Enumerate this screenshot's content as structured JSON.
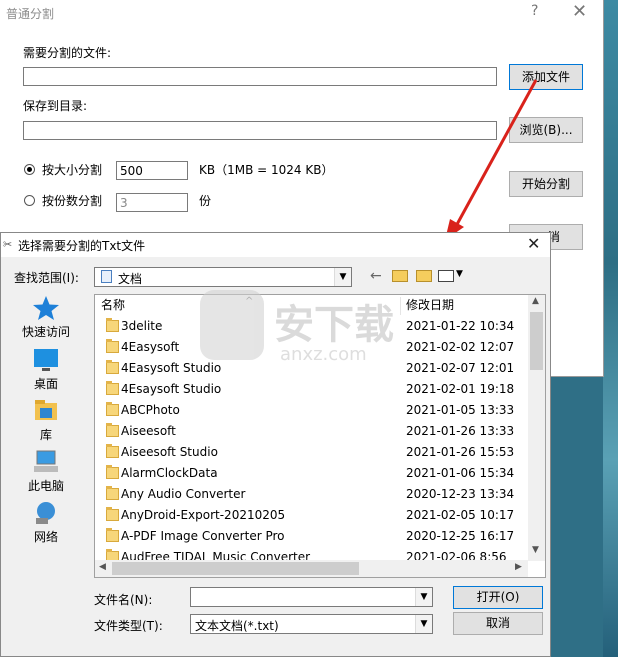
{
  "main_window": {
    "title": "普通分割",
    "help_glyph": "?",
    "close_glyph": "✕",
    "source_label": "需要分割的文件:",
    "source_value": "",
    "add_file_button": "添加文件",
    "save_label": "保存到目录:",
    "save_value": "",
    "browse_button": "浏览(B)...",
    "by_size_label": "按大小分割",
    "by_size_value": "500",
    "size_unit": "KB（1MB = 1024 KB）",
    "by_count_label": "按份数分割",
    "by_count_value": "3",
    "count_unit": "份",
    "start_button": "开始分割",
    "partial_button": "消"
  },
  "open_dialog": {
    "title": "选择需要分割的Txt文件",
    "close_glyph": "✕",
    "lookin_label": "查找范围(I):",
    "lookin_value": "文档",
    "places": [
      {
        "label": "快速访问",
        "icon": "quick-access-star-icon"
      },
      {
        "label": "桌面",
        "icon": "desktop-icon"
      },
      {
        "label": "库",
        "icon": "library-icon"
      },
      {
        "label": "此电脑",
        "icon": "this-pc-icon"
      },
      {
        "label": "网络",
        "icon": "network-icon"
      }
    ],
    "columns": {
      "name": "名称",
      "modified": "修改日期"
    },
    "files": [
      {
        "name": "3delite",
        "date": "2021-01-22 10:34"
      },
      {
        "name": "4Easysoft",
        "date": "2021-02-02 12:07"
      },
      {
        "name": "4Easysoft Studio",
        "date": "2021-02-07 12:01"
      },
      {
        "name": "4Esaysoft Studio",
        "date": "2021-02-01 19:18"
      },
      {
        "name": "ABCPhoto",
        "date": "2021-01-05 13:33"
      },
      {
        "name": "Aiseesoft",
        "date": "2021-01-26 13:33"
      },
      {
        "name": "Aiseesoft Studio",
        "date": "2021-01-26 15:53"
      },
      {
        "name": "AlarmClockData",
        "date": "2021-01-06 15:34"
      },
      {
        "name": "Any Audio Converter",
        "date": "2020-12-23 13:34"
      },
      {
        "name": "AnyDroid-Export-20210205",
        "date": "2021-02-05 10:17"
      },
      {
        "name": "A-PDF Image Converter Pro",
        "date": "2020-12-25 16:17"
      },
      {
        "name": "AudFree TIDAL Music Converter",
        "date": "2021-02-06 8:56"
      }
    ],
    "filename_label": "文件名(N):",
    "filename_value": "",
    "filetype_label": "文件类型(T):",
    "filetype_value": "文本文档(*.txt)",
    "open_button": "打开(O)",
    "cancel_button": "取消"
  },
  "watermark": {
    "text": "安下载",
    "sub": "anxz.com"
  },
  "colors": {
    "accent": "#0078d7",
    "arrow": "#d9221b"
  }
}
